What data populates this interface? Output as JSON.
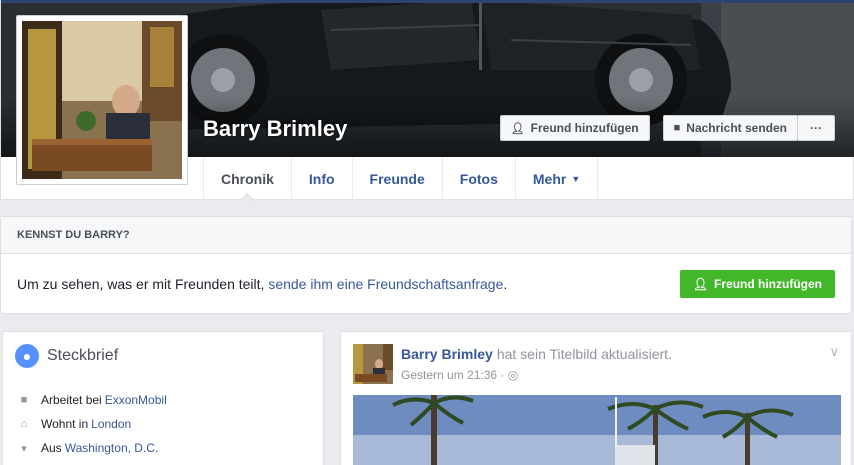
{
  "profile": {
    "name": "Barry Brimley"
  },
  "actions": {
    "add_friend": "Freund hinzufügen",
    "message": "Nachricht senden",
    "more": "···"
  },
  "tabs": [
    {
      "label": "Chronik"
    },
    {
      "label": "Info"
    },
    {
      "label": "Freunde"
    },
    {
      "label": "Fotos"
    },
    {
      "label": "Mehr"
    }
  ],
  "know": {
    "heading": "KENNST DU BARRY?",
    "text_prefix": "Um zu sehen, was er mit Freunden teilt,",
    "link": "sende ihm eine Freundschaftsanfrage",
    "text_suffix": ".",
    "button": "Freund hinzufügen"
  },
  "intro": {
    "title": "Steckbrief",
    "rows": [
      {
        "prefix": "Arbeitet bei",
        "link": "ExxonMobil",
        "icon": "briefcase-icon"
      },
      {
        "prefix": "Wohnt in",
        "link": "London",
        "icon": "home-icon"
      },
      {
        "prefix": "Aus",
        "link": "Washington, D.C.",
        "icon": "map-pin-icon"
      }
    ]
  },
  "post": {
    "author": "Barry Brimley",
    "action": "hat sein Titelbild aktualisiert.",
    "time": "Gestern um 21:36",
    "audience_icon": "globe-icon"
  },
  "colors": {
    "link": "#365899",
    "green": "#42b72a",
    "background": "#e9ebee"
  }
}
